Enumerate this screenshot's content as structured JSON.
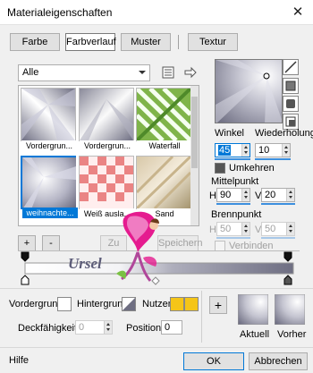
{
  "window": {
    "title": "Materialeigenschaften",
    "close_symbol": "✕"
  },
  "tabs": [
    {
      "label": "Farbe"
    },
    {
      "label": "Farbverlauf",
      "active": true
    },
    {
      "label": "Muster"
    },
    {
      "label": "Textur"
    }
  ],
  "presets": {
    "category": "Alle",
    "swatches": [
      {
        "label": "Vordergrun..."
      },
      {
        "label": "Vordergrun..."
      },
      {
        "label": "Waterfall"
      },
      {
        "label": "weihnachte...",
        "selected": true
      },
      {
        "label": "Weiß ausla..."
      },
      {
        "label": "Sand"
      }
    ],
    "add_label": "+",
    "remove_label": "-",
    "zoom_label": "Zu",
    "save_label": "Speichern"
  },
  "settings": {
    "angle_label": "Winkel",
    "angle_value": "45",
    "repeat_label": "Wiederholung",
    "repeat_value": "10",
    "invert_label": "Umkehren",
    "midpoint_label": "Mittelpunkt",
    "midpoint_h_label": "H",
    "midpoint_h": "90",
    "midpoint_v_label": "V",
    "midpoint_v": "20",
    "focal_label": "Brennpunkt",
    "focal_h_label": "H",
    "focal_h": "50",
    "focal_v_label": "V",
    "focal_v": "50",
    "link_label": "Verbinden"
  },
  "watermark": "Ursel",
  "bottom": {
    "foreground_label": "Vordergrund:",
    "background_label": "Hintergrund:",
    "use_label": "Nutzen",
    "opacity_label": "Deckfähigkeit:",
    "opacity_value": "0",
    "position_label": "Position:",
    "position_value": "0",
    "add_symbol": "+",
    "current_label": "Aktuell",
    "previous_label": "Vorher"
  },
  "footer": {
    "help_label": "Hilfe",
    "ok_label": "OK",
    "cancel_label": "Abbrechen"
  },
  "colors": {
    "accent": "#0078d7",
    "use_swatch": "#f5c518",
    "gradient_light": "#ffffff",
    "gradient_dark": "#6e6e82"
  }
}
